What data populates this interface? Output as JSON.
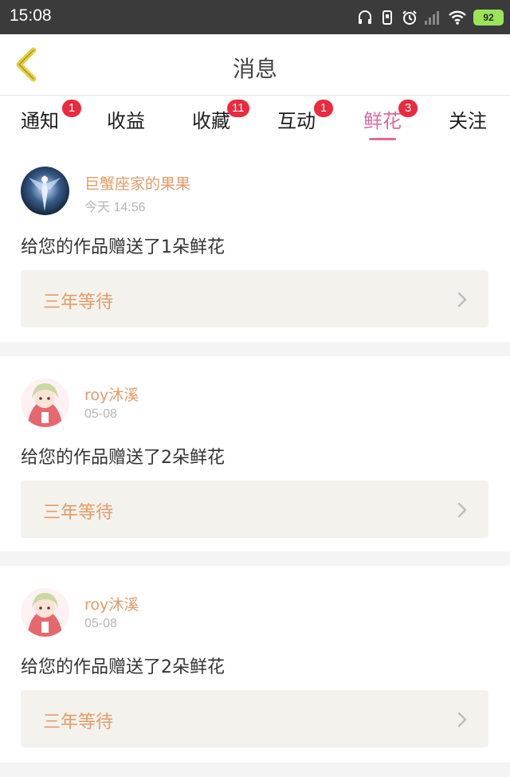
{
  "status_bar": {
    "time": "15:08",
    "battery": "92"
  },
  "header": {
    "title": "消息"
  },
  "tabs": [
    {
      "label": "通知",
      "badge": "1"
    },
    {
      "label": "收益",
      "badge": ""
    },
    {
      "label": "收藏",
      "badge": "11"
    },
    {
      "label": "互动",
      "badge": "1"
    },
    {
      "label": "鲜花",
      "badge": "3",
      "active": true
    },
    {
      "label": "关注",
      "badge": ""
    }
  ],
  "messages": [
    {
      "user": "巨蟹座家的果果",
      "time": "今天 14:56",
      "text": "给您的作品赠送了1朵鲜花",
      "work": "三年等待"
    },
    {
      "user": "roy沐溪",
      "time": "05-08",
      "text": "给您的作品赠送了2朵鲜花",
      "work": "三年等待"
    },
    {
      "user": "roy沐溪",
      "time": "05-08",
      "text": "给您的作品赠送了2朵鲜花",
      "work": "三年等待"
    }
  ],
  "colors": {
    "accent": "#e0679b",
    "name": "#e49b6a",
    "badge": "#ea2a3f",
    "back_arrow": "#e8cf3c"
  }
}
